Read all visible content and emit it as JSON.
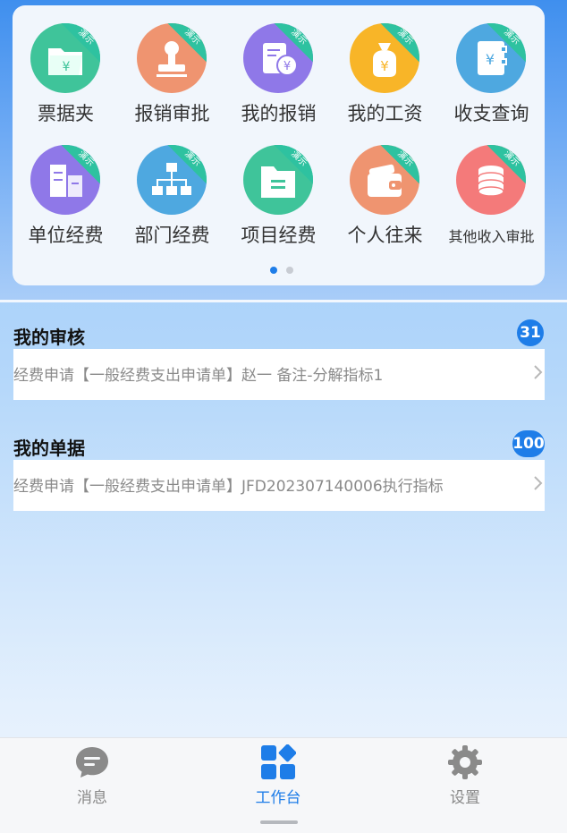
{
  "theme": {
    "accent": "#1e7de8",
    "demo_ribbon": "#2ec2a0"
  },
  "apps": [
    {
      "label": "票据夹",
      "icon": "folder-yen-icon",
      "color": "#3fc49a",
      "demo": "演示"
    },
    {
      "label": "报销审批",
      "icon": "stamp-icon",
      "color": "#ef9470",
      "demo": "演示"
    },
    {
      "label": "我的报销",
      "icon": "document-yen-icon",
      "color": "#8f78e8",
      "demo": "演示"
    },
    {
      "label": "我的工资",
      "icon": "money-bag-icon",
      "color": "#f8b528",
      "demo": "演示"
    },
    {
      "label": "收支查询",
      "icon": "ledger-yen-icon",
      "color": "#4ea8e0",
      "demo": "演示"
    },
    {
      "label": "单位经费",
      "icon": "building-icon",
      "color": "#8f78e8",
      "demo": "演示"
    },
    {
      "label": "部门经费",
      "icon": "org-chart-icon",
      "color": "#4ea8e0",
      "demo": "演示"
    },
    {
      "label": "项目经费",
      "icon": "folder-icon",
      "color": "#3fc49a",
      "demo": "演示"
    },
    {
      "label": "个人往来",
      "icon": "wallet-icon",
      "color": "#ef9470",
      "demo": "演示"
    },
    {
      "label": "其他收入审批",
      "icon": "coins-stack-icon",
      "color": "#f47a7a",
      "demo": "演示"
    }
  ],
  "pager": {
    "pages": 2,
    "current": 1
  },
  "review": {
    "title": "我的审核",
    "count": "31",
    "item_text": "经费申请【一般经费支出申请单】赵一 备注-分解指标1"
  },
  "documents": {
    "title": "我的单据",
    "count": "100",
    "item_text": "经费申请【一般经费支出申请单】JFD202307140006执行指标"
  },
  "tabbar": {
    "messages": "消息",
    "workbench": "工作台",
    "settings": "设置",
    "active": "workbench"
  }
}
